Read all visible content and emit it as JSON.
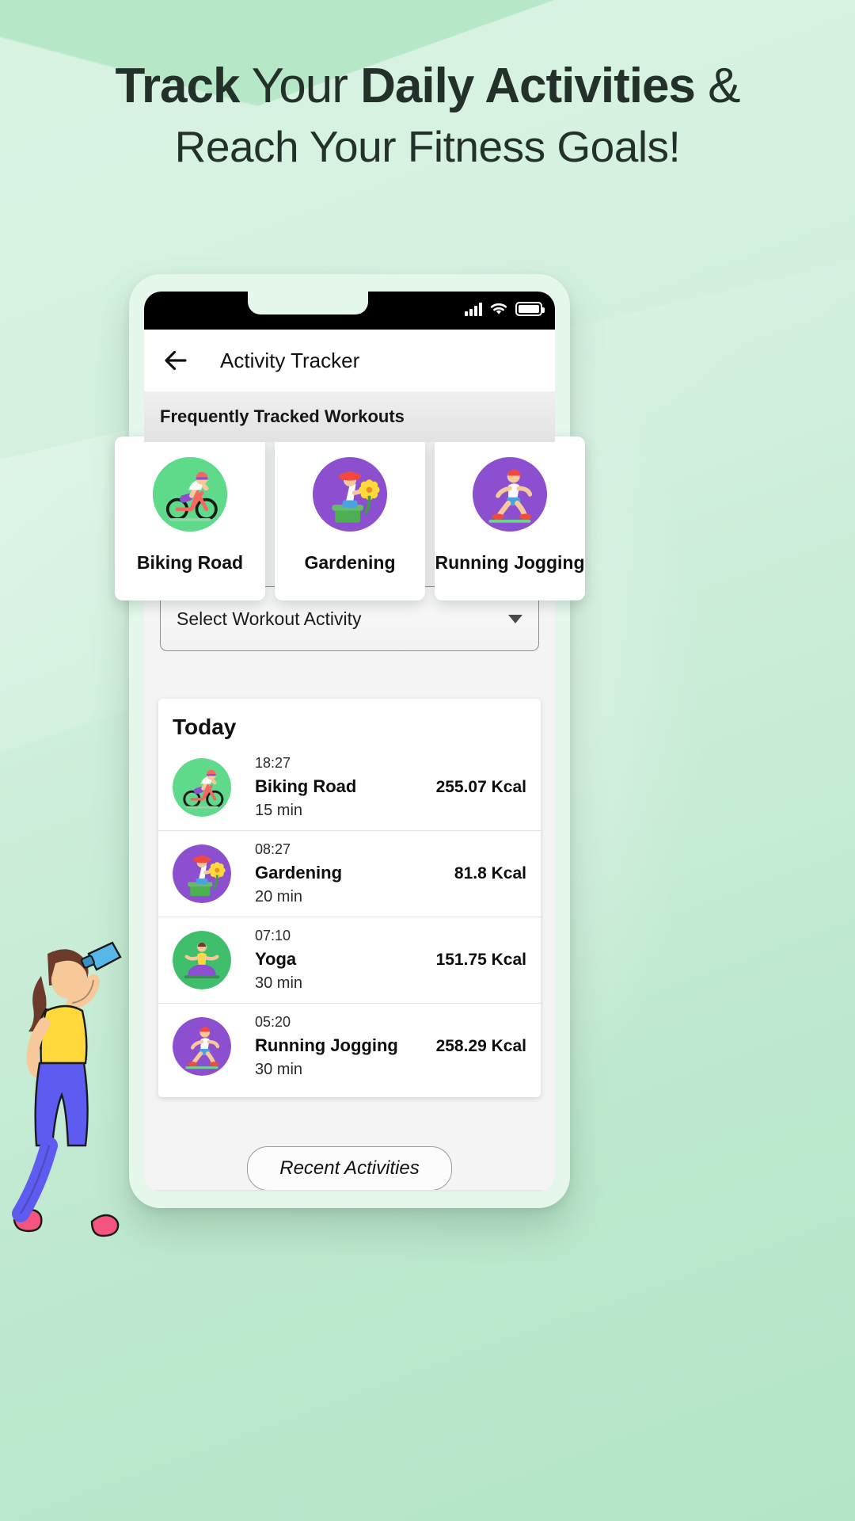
{
  "promo": {
    "headline_line1_part1": "Track",
    "headline_line1_part2": "Your",
    "headline_line1_part3": "Daily Activities",
    "headline_line1_part4": "&",
    "headline_line2": "Reach Your Fitness Goals!"
  },
  "statusbar": {
    "signal_icon": "signal-bars-icon",
    "wifi_icon": "wifi-icon",
    "battery_icon": "battery-full-icon"
  },
  "appbar": {
    "back_icon": "back-arrow-icon",
    "title": "Activity Tracker"
  },
  "section": {
    "frequent_title": "Frequently Tracked Workouts"
  },
  "frequent_cards": [
    {
      "label": "Biking Road",
      "icon": "cyclist-icon",
      "circle_color": "#5fd98a"
    },
    {
      "label": "Gardening",
      "icon": "gardening-icon",
      "circle_color": "#8b4fd0"
    },
    {
      "label": "Running Jogging",
      "icon": "runner-icon",
      "circle_color": "#8b4fd0"
    }
  ],
  "dropdown": {
    "label": "Select Workout Activity",
    "caret_icon": "chevron-down-icon"
  },
  "today": {
    "title": "Today",
    "rows": [
      {
        "time": "18:27",
        "name": "Biking Road",
        "duration": "15 min",
        "kcal": "255.07 Kcal",
        "icon": "cyclist-icon",
        "circle_color": "#5fd98a"
      },
      {
        "time": "08:27",
        "name": "Gardening",
        "duration": "20 min",
        "kcal": "81.8 Kcal",
        "icon": "gardening-icon",
        "circle_color": "#8b4fd0"
      },
      {
        "time": "07:10",
        "name": "Yoga",
        "duration": "30 min",
        "kcal": "151.75 Kcal",
        "icon": "yoga-icon",
        "circle_color": "#3fbf6b"
      },
      {
        "time": "05:20",
        "name": "Running Jogging",
        "duration": "30 min",
        "kcal": "258.29 Kcal",
        "icon": "runner-icon",
        "circle_color": "#8b4fd0"
      }
    ]
  },
  "footer": {
    "recent_label": "Recent Activities"
  },
  "navbar": {
    "back_icon": "nav-back-triangle-icon",
    "home_icon": "nav-home-circle-icon",
    "recents_icon": "nav-recents-square-icon"
  },
  "decor": {
    "woman_illustration": "woman-drinking-water-illustration"
  },
  "colors": {
    "background_mint": "#d2f0de",
    "phone_bezel": "#e4f7ea",
    "green_accent": "#5fd98a",
    "purple_accent": "#8b4fd0",
    "text_dark": "#101010"
  }
}
